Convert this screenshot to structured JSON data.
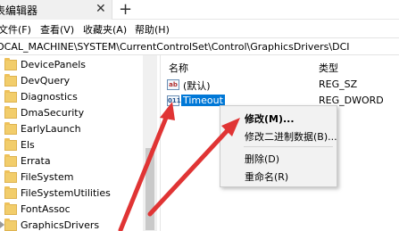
{
  "window": {
    "tab_title": "表编辑器",
    "close_glyph": "✕",
    "new_tab_glyph": "+"
  },
  "menubar": {
    "items": [
      "文件(F)",
      "查看(V)",
      "收藏夹(A)",
      "帮助(H)"
    ]
  },
  "address": {
    "path": "OCAL_MACHINE\\SYSTEM\\CurrentControlSet\\Control\\GraphicsDrivers\\DCI"
  },
  "tree": {
    "items": [
      {
        "label": "DevicePanels"
      },
      {
        "label": "DevQuery"
      },
      {
        "label": "Diagnostics"
      },
      {
        "label": "DmaSecurity"
      },
      {
        "label": "EarlyLaunch"
      },
      {
        "label": "Els"
      },
      {
        "label": "Errata"
      },
      {
        "label": "FileSystem"
      },
      {
        "label": "FileSystemUtilities"
      },
      {
        "label": "FontAssoc"
      },
      {
        "label": "GraphicsDrivers"
      }
    ]
  },
  "values_list": {
    "header_name": "名称",
    "header_type": "类型",
    "rows": [
      {
        "icon": "ab",
        "name": "(默认)",
        "type": "REG_SZ"
      },
      {
        "icon": "011",
        "name": "Timeout",
        "type": "REG_DWORD"
      }
    ]
  },
  "context_menu": {
    "items": [
      "修改(M)...",
      "修改二进制数据(B)...",
      "删除(D)",
      "重命名(R)"
    ]
  },
  "colors": {
    "selection": "#0078d7",
    "arrow": "#e03434"
  },
  "icons": {
    "folder": "folder-icon",
    "string_value": "string-value-icon",
    "binary_value": "binary-value-icon"
  }
}
